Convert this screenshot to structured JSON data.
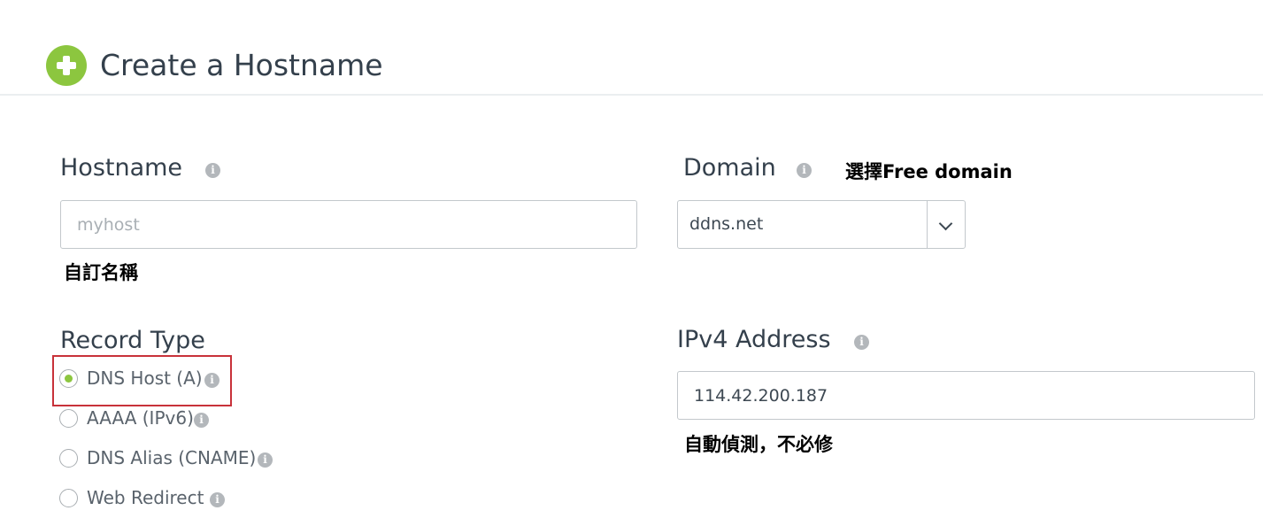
{
  "header": {
    "title": "Create a Hostname",
    "icon": "plus-circle-icon",
    "accent": "#8cc63f"
  },
  "hostname": {
    "label": "Hostname",
    "placeholder": "myhost",
    "value": "",
    "annotation": "自訂名稱"
  },
  "domain": {
    "label": "Domain",
    "selected": "ddns.net",
    "annotation": "選擇Free domain"
  },
  "record_type": {
    "label": "Record Type",
    "options": [
      {
        "label": "DNS Host (A)",
        "checked": true
      },
      {
        "label": "AAAA (IPv6)",
        "checked": false
      },
      {
        "label": "DNS Alias (CNAME)",
        "checked": false
      },
      {
        "label": "Web Redirect",
        "checked": false
      }
    ],
    "highlight_color": "#c8323a"
  },
  "ipv4": {
    "label": "IPv4 Address",
    "value": "114.42.200.187",
    "annotation": "自動偵測，不必修"
  },
  "info_glyph": "i"
}
